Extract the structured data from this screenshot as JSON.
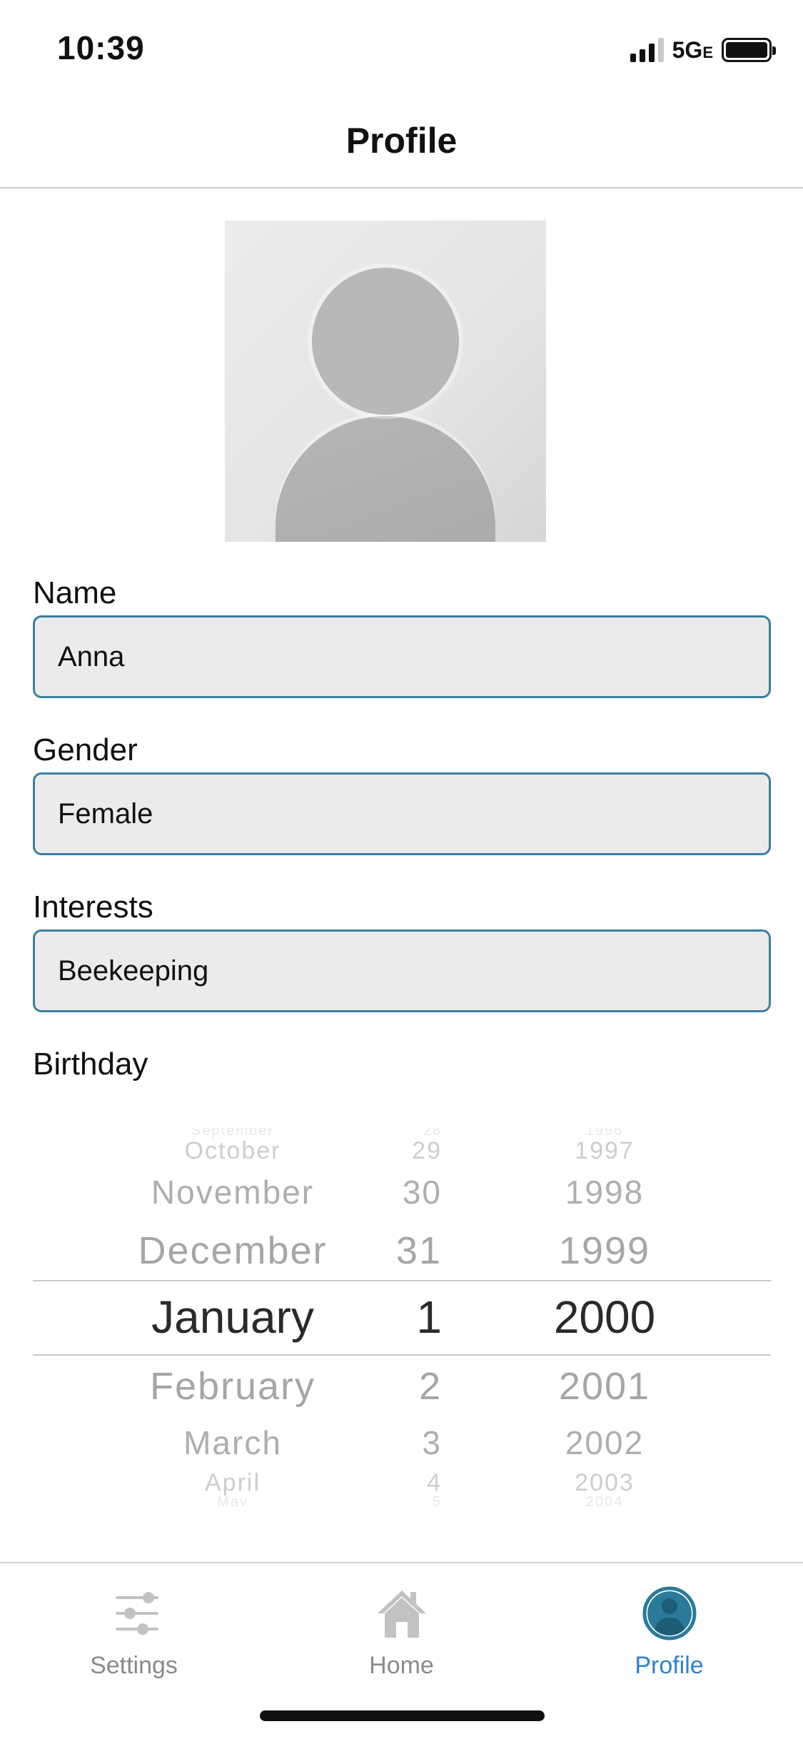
{
  "status_bar": {
    "time": "10:39",
    "network": "5G",
    "network_suffix": "E"
  },
  "nav": {
    "title": "Profile"
  },
  "form": {
    "name": {
      "label": "Name",
      "value": "Anna"
    },
    "gender": {
      "label": "Gender",
      "value": "Female"
    },
    "interests": {
      "label": "Interests",
      "value": "Beekeeping"
    },
    "birthday": {
      "label": "Birthday"
    }
  },
  "picker": {
    "months": [
      "September",
      "October",
      "November",
      "December",
      "January",
      "February",
      "March",
      "April",
      "May"
    ],
    "days": [
      "28",
      "29",
      "30",
      "31",
      "1",
      "2",
      "3",
      "4",
      "5"
    ],
    "years": [
      "1996",
      "1997",
      "1998",
      "1999",
      "2000",
      "2001",
      "2002",
      "2003",
      "2004"
    ],
    "selected": {
      "month": "January",
      "day": "1",
      "year": "2000"
    }
  },
  "tabs": [
    {
      "label": "Settings",
      "icon": "sliders-icon",
      "active": false
    },
    {
      "label": "Home",
      "icon": "home-icon",
      "active": false
    },
    {
      "label": "Profile",
      "icon": "profile-icon",
      "active": true
    }
  ],
  "colors": {
    "field_border": "#3a7fa0",
    "field_background": "#ebebeb",
    "active_tab": "#2f80d5",
    "inactive_tab": "#8a8a8a"
  }
}
